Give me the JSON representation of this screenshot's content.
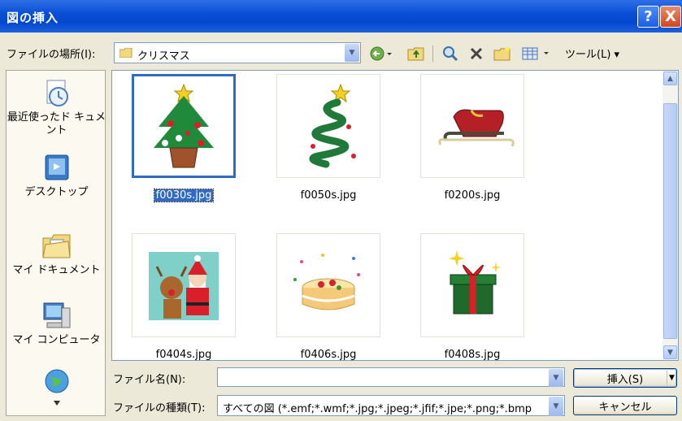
{
  "window": {
    "title": "図の挿入",
    "help_label": "?",
    "close_label": "X"
  },
  "location": {
    "label": "ファイルの場所(I):",
    "value": "クリスマス",
    "tools_label": "ツール(L) ▾"
  },
  "places": [
    {
      "label": "最近使ったド キュメント",
      "icon": "recent-documents-icon"
    },
    {
      "label": "デスクトップ",
      "icon": "desktop-icon"
    },
    {
      "label": "マイ ドキュメント",
      "icon": "my-documents-icon"
    },
    {
      "label": "マイ コンピュータ",
      "icon": "my-computer-icon"
    },
    {
      "label": "",
      "icon": "my-network-icon"
    }
  ],
  "files": [
    {
      "name": "f0030s.jpg",
      "selected": true,
      "icon": "christmas-tree-thumbnail"
    },
    {
      "name": "f0050s.jpg",
      "selected": false,
      "icon": "ribbon-tree-thumbnail"
    },
    {
      "name": "f0200s.jpg",
      "selected": false,
      "icon": "sleigh-thumbnail"
    },
    {
      "name": "f0404s.jpg",
      "selected": false,
      "icon": "santa-reindeer-thumbnail"
    },
    {
      "name": "f0406s.jpg",
      "selected": false,
      "icon": "cake-thumbnail"
    },
    {
      "name": "f0408s.jpg",
      "selected": false,
      "icon": "gift-box-thumbnail"
    }
  ],
  "filename": {
    "label": "ファイル名(N):",
    "value": ""
  },
  "filetype": {
    "label": "ファイルの種類(T):",
    "value": "すべての図 (*.emf;*.wmf;*.jpg;*.jpeg;*.jfif;*.jpe;*.png;*.bmp"
  },
  "buttons": {
    "insert": "挿入(S)",
    "cancel": "キャンセル"
  },
  "colors": {
    "titlebar": "#0a4fd6",
    "selection": "#316ac5",
    "dialog_bg": "#ece9d8"
  }
}
